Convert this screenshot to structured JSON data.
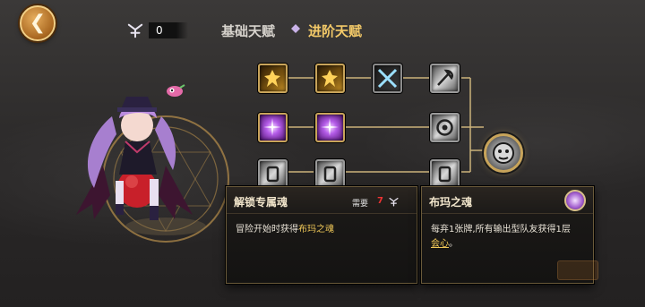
{
  "header": {
    "back_icon": "back-arrow-icon",
    "currency": {
      "icon": "soul-rune-icon",
      "value": "0"
    },
    "tabs": [
      {
        "label": "基础天赋",
        "active": false
      },
      {
        "label": "进阶天赋",
        "active": true
      }
    ]
  },
  "character": {
    "name": "",
    "icon": "character-portrait"
  },
  "talent_tree": {
    "rows": [
      [
        "gold-figure",
        "gold-figure",
        "crossed-blades",
        "silver-axe"
      ],
      [
        "purple-burst",
        "purple-burst",
        "silver-spiral"
      ],
      [
        "silver-rune",
        "silver-rune",
        "silver-rune"
      ]
    ],
    "final_node": "boss-portrait-icon"
  },
  "unlock_popup": {
    "title": "解锁专属魂",
    "cost_label": "需要",
    "cost_value": "7",
    "cost_icon": "soul-rune-icon",
    "desc_prefix": "冒险开始时获得",
    "desc_highlight": "布玛之魂"
  },
  "soul_popup": {
    "title": "布玛之魂",
    "icon": "soul-orb-icon",
    "desc_main": "每弃1张牌,所有输出型队友获得1层",
    "desc_keyword": "会心",
    "desc_end": "。"
  },
  "colors": {
    "gold": "#f3c968",
    "cost_red": "#ee3333",
    "highlight": "#f0c858",
    "panel_bg": "#1c1a18"
  }
}
